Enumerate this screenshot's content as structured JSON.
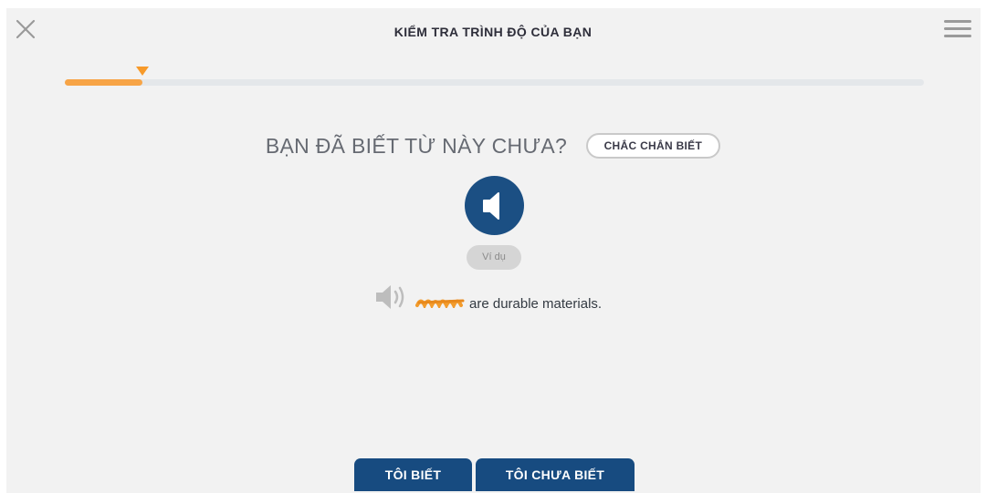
{
  "header": {
    "title": "KIỂM TRA TRÌNH ĐỘ CỦA BẠN",
    "close_icon": "close-icon",
    "menu_icon": "hamburger-menu-icon"
  },
  "progress": {
    "value_percent": 9,
    "fill_color": "#f7a446",
    "marker_color": "#f79a2a"
  },
  "question": {
    "text": "BẠN ĐÃ BIẾT TỪ NÀY CHƯA?",
    "sure_button": "CHẮC CHẮN BIẾT"
  },
  "audio": {
    "icon": "speaker-icon",
    "color": "#1b4f83"
  },
  "example": {
    "label": "Ví dụ",
    "speaker_icon": "speaker-wave-icon",
    "sentence": "are durable materials."
  },
  "actions": {
    "know": "TÔI BIẾT",
    "not_know": "TÔI CHƯA BIẾT",
    "color": "#174b80"
  }
}
